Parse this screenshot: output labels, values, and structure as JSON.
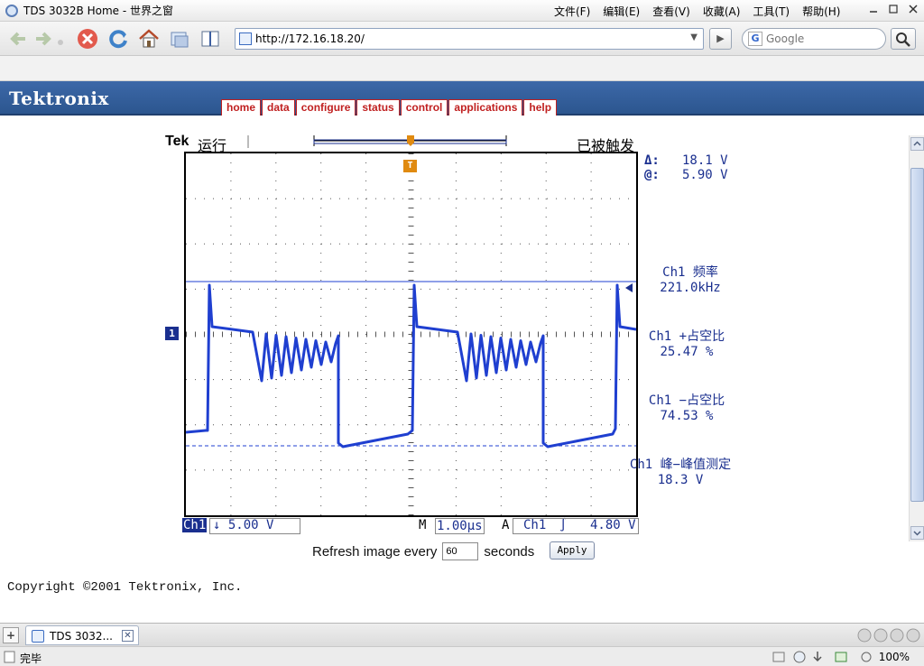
{
  "window": {
    "title": "TDS 3032B Home - 世界之窗",
    "menu": [
      "文件(F)",
      "编辑(E)",
      "查看(V)",
      "收藏(A)",
      "工具(T)",
      "帮助(H)"
    ]
  },
  "toolbar": {
    "url": "http://172.16.18.20/",
    "search_placeholder": "Google"
  },
  "header": {
    "logo": "Tektronix",
    "nav": [
      "home",
      "data",
      "configure",
      "status",
      "control",
      "applications",
      "help"
    ]
  },
  "scope": {
    "brand": "Tek",
    "run_state": "运行",
    "trigger_state": "已被触发",
    "cursor_delta": "18.1 V",
    "cursor_at": "5.90 V",
    "delta_symbol": "Δ:",
    "at_symbol": "@:",
    "trigger_marker": "T",
    "ch_marker": "1",
    "measurements": [
      {
        "label": "Ch1 频率",
        "value": "221.0kHz"
      },
      {
        "label": "Ch1 +占空比",
        "value": "25.47 %"
      },
      {
        "label": "Ch1 −占空比",
        "value": "74.53 %"
      },
      {
        "label": "Ch1 峰−峰值测定",
        "value": "18.3 V"
      }
    ],
    "ch_label": "Ch1",
    "volts_div": "↓ 5.00 V",
    "m_label": "M",
    "time_div": "1.00µs",
    "a_label": "A",
    "trig_channel": "Ch1",
    "trig_slope": "∫",
    "trig_level": "4.80 V"
  },
  "refresh": {
    "prefix": "Refresh image every",
    "value": "60",
    "suffix": "seconds",
    "apply": "Apply"
  },
  "copyright": "Copyright ©2001 Tektronix, Inc.",
  "tabbar": {
    "tab_label": "TDS 3032..."
  },
  "status": {
    "text": "完毕",
    "zoom": "100%"
  },
  "colors": {
    "waveform": "#1f3fd0",
    "scope_text": "#1a2f8f",
    "header_blue": "#2f5b98",
    "tab_red": "#c02020"
  }
}
